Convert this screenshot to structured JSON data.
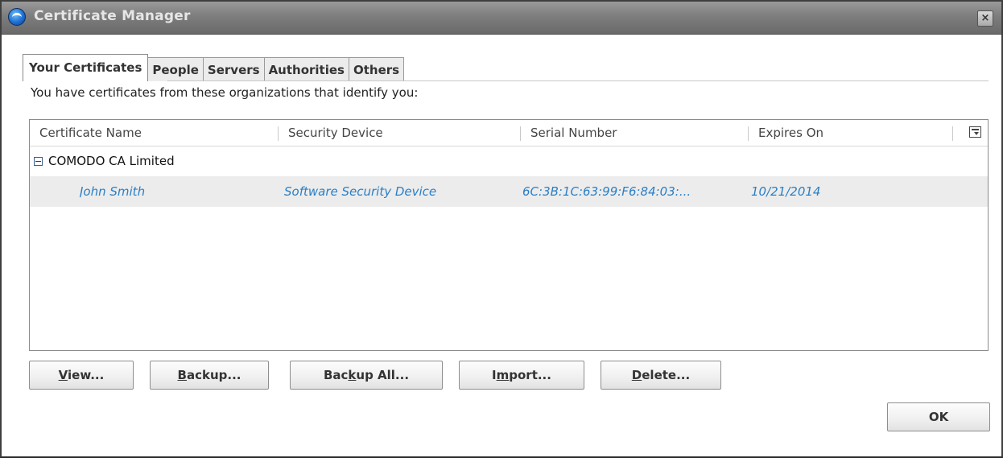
{
  "window": {
    "title": "Certificate Manager",
    "close_glyph": "×",
    "app_icon": "app-globe-icon",
    "close_icon": "close-icon"
  },
  "tabs": [
    {
      "label": "Your Certificates",
      "selected": true
    },
    {
      "label": "People",
      "selected": false
    },
    {
      "label": "Servers",
      "selected": false
    },
    {
      "label": "Authorities",
      "selected": false
    },
    {
      "label": "Others",
      "selected": false
    }
  ],
  "description": "You have certificates from these organizations that identify you:",
  "tree": {
    "columns": [
      "Certificate Name",
      "Security Device",
      "Serial Number",
      "Expires On"
    ],
    "column_picker_icon": "column-picker-icon",
    "groups": [
      {
        "name": "COMODO CA Limited",
        "expanded": true,
        "rows": [
          {
            "certificate_name": "John Smith",
            "security_device": "Software Security Device",
            "serial_number": "6C:3B:1C:63:99:F6:84:03:...",
            "expires_on": "10/21/2014",
            "selected": true
          }
        ]
      }
    ]
  },
  "buttons": {
    "view": {
      "pre": "",
      "accel": "V",
      "post": "iew..."
    },
    "backup": {
      "pre": "",
      "accel": "B",
      "post": "ackup..."
    },
    "backup_all": {
      "pre": "Bac",
      "accel": "k",
      "post": "up All..."
    },
    "import": {
      "pre": "I",
      "accel": "m",
      "post": "port..."
    },
    "delete": {
      "pre": "",
      "accel": "D",
      "post": "elete..."
    },
    "ok": {
      "label": "OK"
    }
  },
  "colors": {
    "selected_row_text": "#2a7fc6",
    "selected_row_background": "#ececec",
    "titlebar": "#7d7d7d"
  }
}
